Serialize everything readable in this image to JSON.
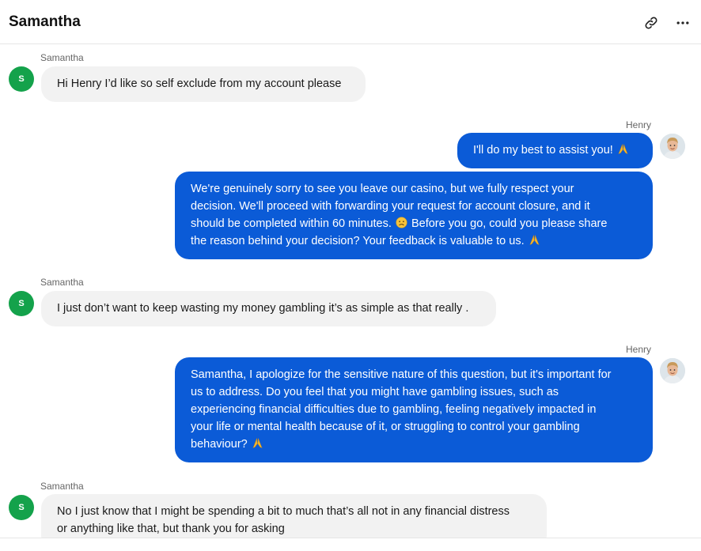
{
  "header": {
    "title": "Samantha"
  },
  "messages": [
    {
      "sender": "Samantha",
      "avatar_initial": "S",
      "text": "Hi Henry I’d like so self exclude from my account please"
    },
    {
      "sender": "Henry",
      "bubble1": "I'll do my best to assist you!",
      "bubble2_lines": [
        "We're genuinely sorry to see you leave our casino, but we fully respect your",
        "decision. We'll proceed with forwarding your request for account closure, and it",
        "should be completed within 60 minutes.",
        "Before you go, could you please share",
        "the reason behind your decision? Your feedback is valuable to us."
      ]
    },
    {
      "sender": "Samantha",
      "avatar_initial": "S",
      "text": "I just don’t want to keep wasting my money gambling it’s as simple as that really ."
    },
    {
      "sender": "Henry",
      "lines": [
        "Samantha, I apologize for the sensitive nature of this question, but it's important for",
        "us to address. Do you feel that you might have gambling issues, such as",
        "experiencing financial difficulties due to gambling, feeling negatively impacted in",
        "your life or mental health because of it, or struggling to control your gambling",
        "behaviour?"
      ]
    },
    {
      "sender": "Samantha",
      "avatar_initial": "S",
      "lines": [
        "No I just know that I might be spending a bit to much that’s all not in any financial distress",
        "or anything like that, but thank you for asking"
      ]
    }
  ],
  "icons": {
    "link": "link-icon",
    "more": "more-horizontal-icon",
    "pray": "folded-hands-emoji",
    "sad": "worried-face-emoji"
  },
  "colors": {
    "outgoing_bubble": "#0b5bd7",
    "incoming_bubble": "#f2f2f2",
    "avatar_green": "#14a24b"
  }
}
